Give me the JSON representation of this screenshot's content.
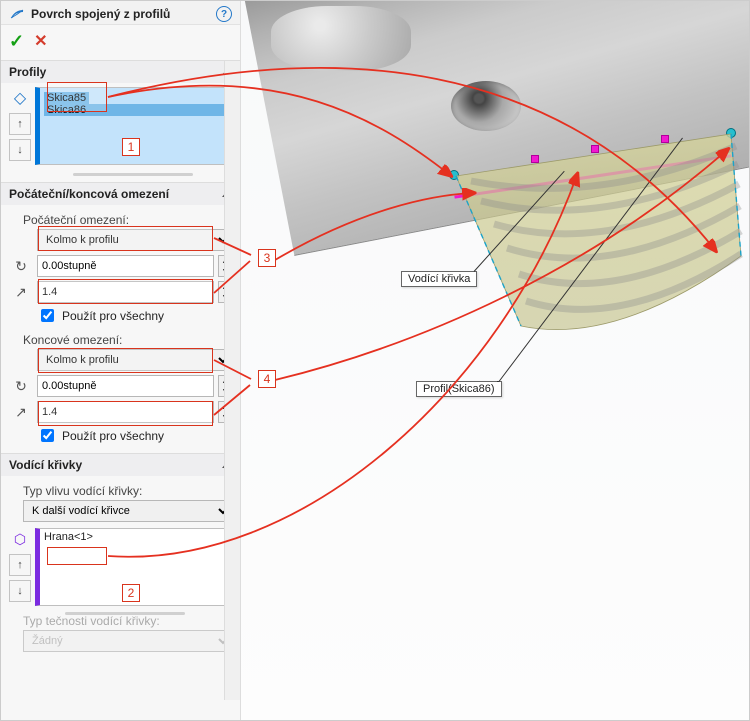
{
  "header": {
    "title": "Povrch spojený z profilů"
  },
  "sections": {
    "profiles": {
      "label": "Profily",
      "items": [
        "Skica85",
        "Skica86"
      ]
    },
    "constraints": {
      "label": "Počáteční/koncová omezení",
      "start_label": "Počáteční omezení:",
      "start_type": "Kolmo k profilu",
      "start_angle": "0.00stupně",
      "start_len": "1.4",
      "apply_all": "Použít pro všechny",
      "end_label": "Koncové omezení:",
      "end_type": "Kolmo k profilu",
      "end_angle": "0.00stupně",
      "end_len": "1.4"
    },
    "guides": {
      "label": "Vodící křivky",
      "type_label": "Typ vlivu vodící křivky:",
      "type_value": "K další vodící křivce",
      "items": [
        "Hrana<1>"
      ],
      "tangent_label": "Typ tečnosti vodící křivky:",
      "tangent_value": "Žádný"
    }
  },
  "callouts": {
    "a": "Vodící křivka",
    "b": "Profil(Skica86)"
  },
  "annotations": {
    "n1": "1",
    "n2": "2",
    "n3": "3",
    "n4": "4"
  }
}
